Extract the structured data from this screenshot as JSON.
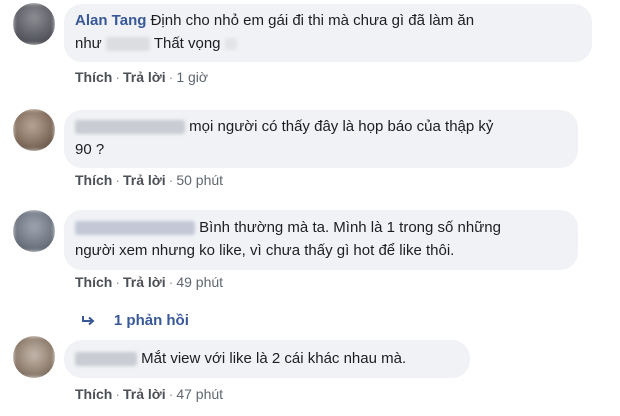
{
  "comments": [
    {
      "name": "Alan Tang",
      "line1": "Định cho nhỏ em gái đi thi mà chưa gì đã làm ăn",
      "line2_prefix": "như",
      "line2_mid": "Thất vọng",
      "like": "Thích",
      "reply": "Trả lời",
      "time": "1 giờ"
    },
    {
      "line1": "mọi người có thấy đây là họp báo của thập kỷ",
      "line2": "90 ?",
      "like": "Thích",
      "reply": "Trả lời",
      "time": "50 phút"
    },
    {
      "line1": "Bình thường mà ta. Mình là 1 trong số những",
      "line2": "người xem nhưng ko like, vì chưa thấy gì hot để like thôi.",
      "like": "Thích",
      "reply": "Trả lời",
      "time": "49 phút",
      "replies_label": "1 phản hồi"
    },
    {
      "line1": "Mắt view với like là 2 cái khác nhau mà.",
      "like": "Thích",
      "reply": "Trả lời",
      "time": "47 phút"
    }
  ],
  "colors": {
    "bubble": "#f0f2f5",
    "name": "#385898",
    "meta": "#606770"
  },
  "icons": {
    "reply_arrow": "reply-arrow-icon"
  }
}
